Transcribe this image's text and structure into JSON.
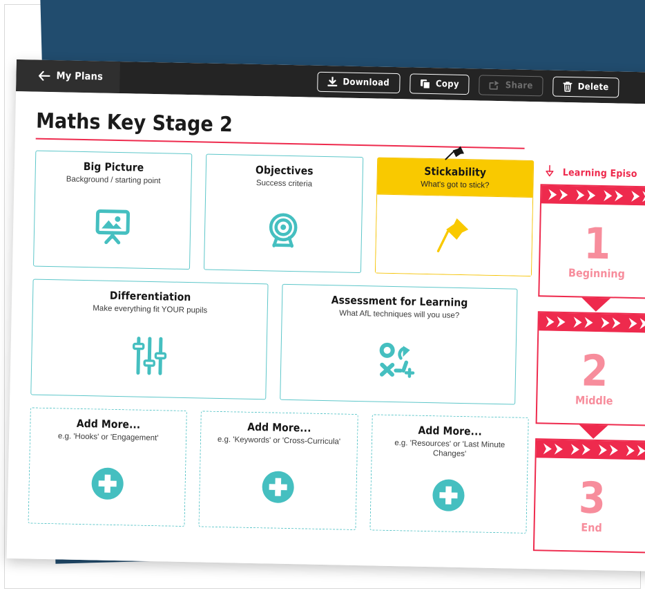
{
  "window": {
    "toolbar": {
      "back_label": "My Plans",
      "back_icon": "arrow-left-icon",
      "actions": [
        {
          "label": "Download",
          "icon": "download-icon",
          "disabled": false
        },
        {
          "label": "Copy",
          "icon": "copy-icon",
          "disabled": false
        },
        {
          "label": "Share",
          "icon": "share-icon",
          "disabled": true
        },
        {
          "label": "Delete",
          "icon": "trash-icon",
          "disabled": false
        }
      ]
    },
    "plan": {
      "title": "Maths Key Stage 2"
    },
    "cards": {
      "big_picture": {
        "title": "Big Picture",
        "subtitle": "Background / starting point",
        "icon": "easel-image-icon"
      },
      "objectives": {
        "title": "Objectives",
        "subtitle": "Success criteria",
        "icon": "target-icon"
      },
      "stickability": {
        "title": "Stickability",
        "subtitle": "What's got to stick?",
        "icon": "pushpin-icon"
      },
      "differentiation": {
        "title": "Differentiation",
        "subtitle": "Make everything fit YOUR pupils",
        "icon": "sliders-icon"
      },
      "afl": {
        "title": "Assessment for Learning",
        "subtitle": "What AfL techniques will you use?",
        "icon": "strategy-icon"
      },
      "add_more": [
        {
          "title": "Add More...",
          "subtitle": "e.g. 'Hooks' or 'Engagement'",
          "icon": "plus-circle-icon"
        },
        {
          "title": "Add More...",
          "subtitle": "e.g. 'Keywords' or 'Cross-Curricula'",
          "icon": "plus-circle-icon"
        },
        {
          "title": "Add More...",
          "subtitle": "e.g. 'Resources' or 'Last Minute Changes'",
          "icon": "plus-circle-icon"
        }
      ]
    },
    "episodes": {
      "header_label": "Learning Episo",
      "header_icon": "arrow-down-outline-icon",
      "items": [
        {
          "number": "1",
          "name": "Beginning",
          "has_arrow": true
        },
        {
          "number": "2",
          "name": "Middle",
          "has_arrow": true
        },
        {
          "number": "3",
          "name": "End",
          "has_arrow": false
        }
      ]
    }
  },
  "colors": {
    "backdrop_blue": "#214c6e",
    "toolbar_dark": "#242424",
    "teal": "#45bfc0",
    "yellow": "#f9c900",
    "red": "#ee2a4d",
    "pink": "#f78d9c"
  }
}
